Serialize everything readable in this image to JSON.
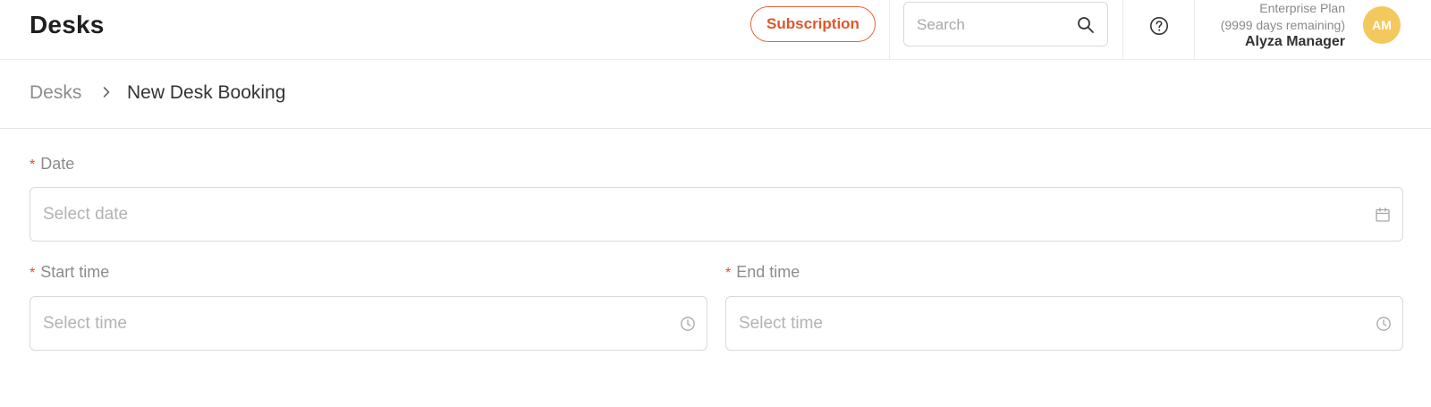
{
  "header": {
    "app_title": "Desks",
    "subscription_label": "Subscription",
    "search": {
      "placeholder": "Search",
      "value": ""
    },
    "user": {
      "plan": "Enterprise Plan",
      "remaining": "(9999 days remaining)",
      "name": "Alyza Manager",
      "initials": "AM"
    }
  },
  "breadcrumb": {
    "root": "Desks",
    "current": "New Desk Booking"
  },
  "form": {
    "date": {
      "required_mark": "*",
      "label": "Date",
      "placeholder": "Select date",
      "value": ""
    },
    "start_time": {
      "required_mark": "*",
      "label": "Start time",
      "placeholder": "Select time",
      "value": ""
    },
    "end_time": {
      "required_mark": "*",
      "label": "End time",
      "placeholder": "Select time",
      "value": ""
    }
  },
  "colors": {
    "accent": "#e0562b",
    "avatar_bg": "#f3c95d",
    "required": "#e04a3a"
  },
  "icons": {
    "search": "search-icon",
    "help": "question-circle-icon",
    "breadcrumb_sep": "chevron-right-icon",
    "date": "calendar-icon",
    "time": "clock-icon"
  }
}
